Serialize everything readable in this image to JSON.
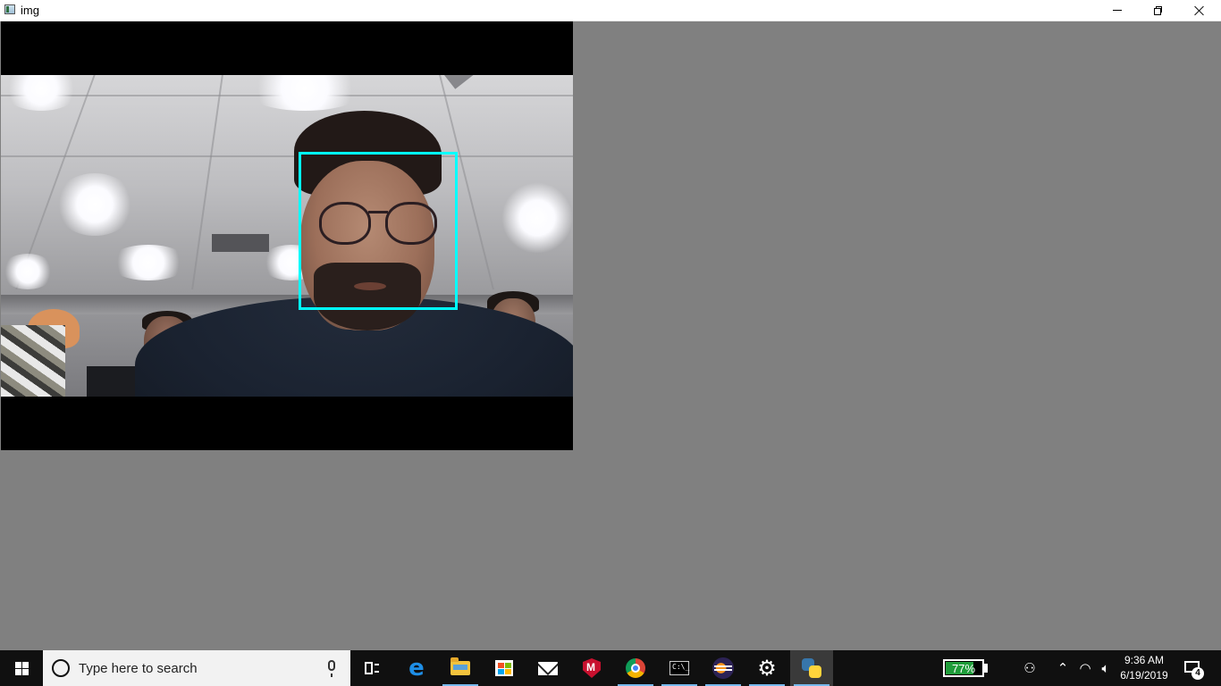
{
  "window": {
    "title": "img",
    "buttons": [
      "minimize",
      "restore",
      "close"
    ]
  },
  "camera": {
    "detection_box_color": "#00ffff",
    "detected_faces": 1
  },
  "taskbar": {
    "search_placeholder": "Type here to search",
    "pinned_apps": [
      "task-view",
      "edge",
      "file-explorer",
      "store",
      "mail",
      "mcafee",
      "chrome",
      "command-prompt",
      "eclipse",
      "settings",
      "python"
    ],
    "battery_percent": 77,
    "battery_label": "77%",
    "clock_time": "9:36 AM",
    "clock_date": "6/19/2019",
    "notification_count": "4"
  },
  "colors": {
    "window_bg": "#808080",
    "taskbar_bg": "#101010",
    "battery_fill": "#1f9c3a",
    "accent": "#76b9ed"
  }
}
